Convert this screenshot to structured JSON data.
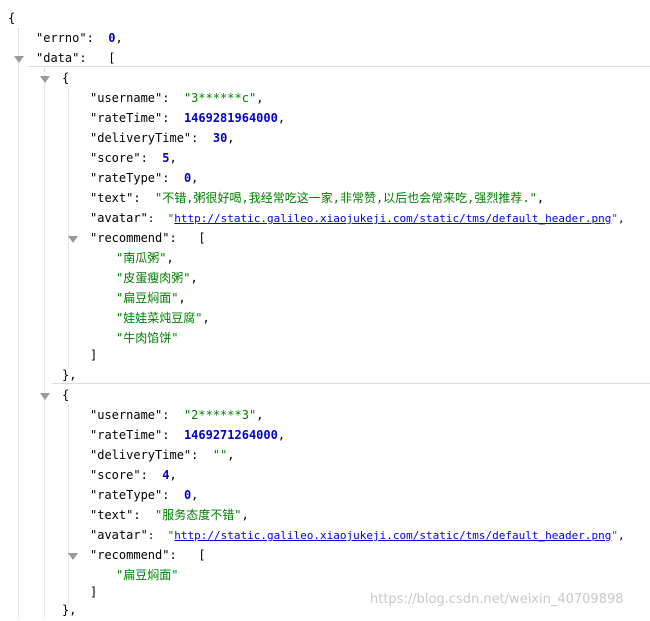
{
  "json": {
    "open_brace": "{",
    "errno_key": "\"errno\"",
    "errno_val": "0",
    "data_key": "\"data\"",
    "open_bracket": "[",
    "items": [
      {
        "username": "\"3******c\"",
        "rateTime": "1469281964000",
        "deliveryTime": "30",
        "score": "5",
        "rateType": "0",
        "text": "\"不错,粥很好喝,我经常吃这一家,非常赞,以后也会常来吃,强烈推荐.\"",
        "avatar": "http://static.galileo.xiaojukeji.com/static/tms/default_header.png",
        "recommend": [
          "\"南瓜粥\"",
          "\"皮蛋瘦肉粥\"",
          "\"扁豆焖面\"",
          "\"娃娃菜炖豆腐\"",
          "\"牛肉馅饼\""
        ]
      },
      {
        "username": "\"2******3\"",
        "rateTime": "1469271264000",
        "deliveryTime": "\"\"",
        "score": "4",
        "rateType": "0",
        "text": "\"服务态度不错\"",
        "avatar": "http://static.galileo.xiaojukeji.com/static/tms/default_header.png",
        "recommend": [
          "\"扁豆焖面\""
        ]
      }
    ],
    "keys": {
      "username": "\"username\"",
      "rateTime": "\"rateTime\"",
      "deliveryTime": "\"deliveryTime\"",
      "score": "\"score\"",
      "rateType": "\"rateType\"",
      "text": "\"text\"",
      "avatar": "\"avatar\"",
      "recommend": "\"recommend\""
    }
  },
  "watermark": "https://blog.csdn.net/weixin_40709898",
  "colors": {
    "string": "#008000",
    "number": "#0000cc",
    "link": "#0000ee",
    "toggle": "#9a9a9a"
  },
  "icons": {
    "collapse_toggle": "triangle-down-icon"
  }
}
